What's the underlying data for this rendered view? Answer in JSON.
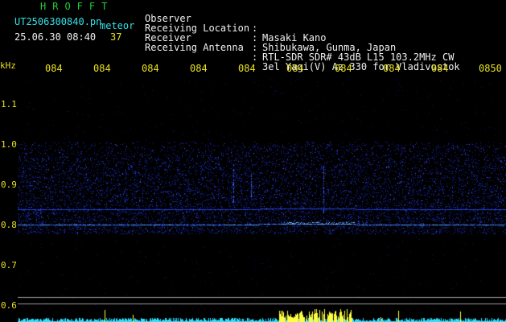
{
  "header": {
    "app_title": "HROFFT",
    "file_name": "UT2506300840.pn",
    "mode": "meteor",
    "date_time": "25.06.30 08:40",
    "count": "37"
  },
  "metadata": [
    {
      "key": "Observer",
      "value": "Masaki Kano"
    },
    {
      "key": "Receiving Location",
      "value": "Shibukawa, Gunma, Japan"
    },
    {
      "key": "Receiver",
      "value": "RTL-SDR SDR# 43dB L15 103.2MHz CW"
    },
    {
      "key": "Receiving Antenna",
      "value": "3el Yagi(V) Az 330 for Vladivostok"
    }
  ],
  "time_axis": {
    "labels": [
      "0841",
      "0842",
      "0843",
      "0844",
      "0845",
      "0846",
      "0847",
      "0848",
      "0849",
      "0850"
    ]
  },
  "freq_axis": {
    "unit": "kHz",
    "labels": [
      "1.1",
      "1.0",
      "0.9",
      "0.8",
      "0.7",
      "0.6"
    ]
  },
  "colors": {
    "background": "#000000",
    "axis_labels": "#e8e020",
    "title": "#22cc33",
    "filename": "#33e0e6",
    "noise": "#1a2cd0",
    "signal_line": "#4fa0ff",
    "meteor_bars": "#ffff40",
    "baseline": "#30e0ff"
  }
}
